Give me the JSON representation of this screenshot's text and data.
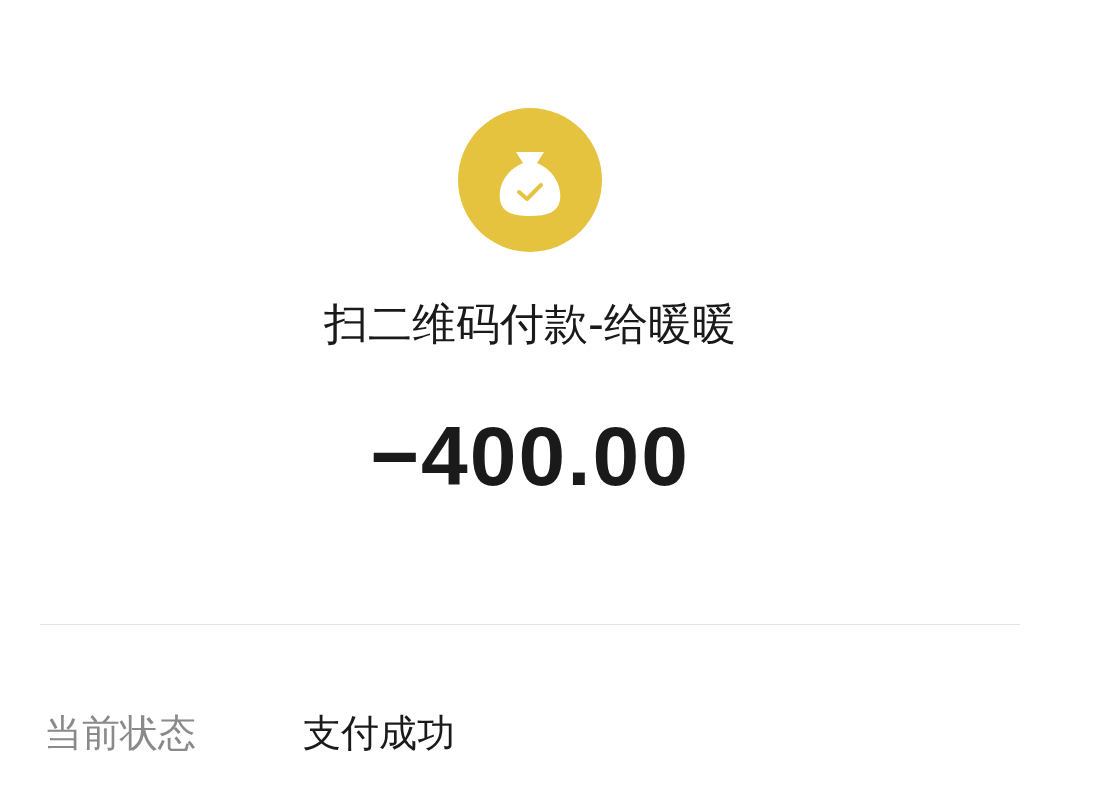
{
  "title": "扫二维码付款-给暖暖",
  "amount": "−400.00",
  "details": [
    {
      "label": "当前状态",
      "value": "支付成功"
    }
  ]
}
